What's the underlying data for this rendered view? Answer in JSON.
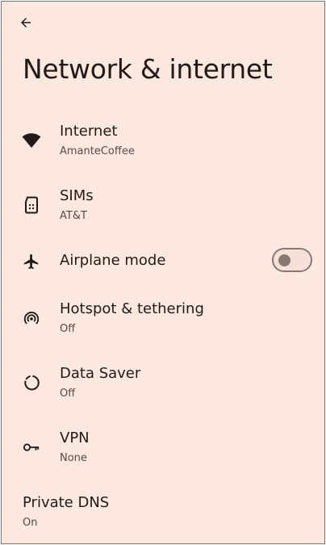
{
  "page": {
    "title": "Network & internet",
    "background": "#fde8e0"
  },
  "items": [
    {
      "title": "Internet",
      "subtitle": "AmanteCoffee",
      "icon": "wifi-icon"
    },
    {
      "title": "SIMs",
      "subtitle": "AT&T",
      "icon": "sim-card-icon"
    },
    {
      "title": "Airplane mode",
      "icon": "airplane-icon",
      "toggle_on": false
    },
    {
      "title": "Hotspot & tethering",
      "subtitle": "Off",
      "icon": "hotspot-icon"
    },
    {
      "title": "Data Saver",
      "subtitle": "Off",
      "icon": "data-saver-icon"
    },
    {
      "title": "VPN",
      "subtitle": "None",
      "icon": "vpn-key-icon"
    },
    {
      "title": "Private DNS",
      "subtitle": "On"
    }
  ]
}
